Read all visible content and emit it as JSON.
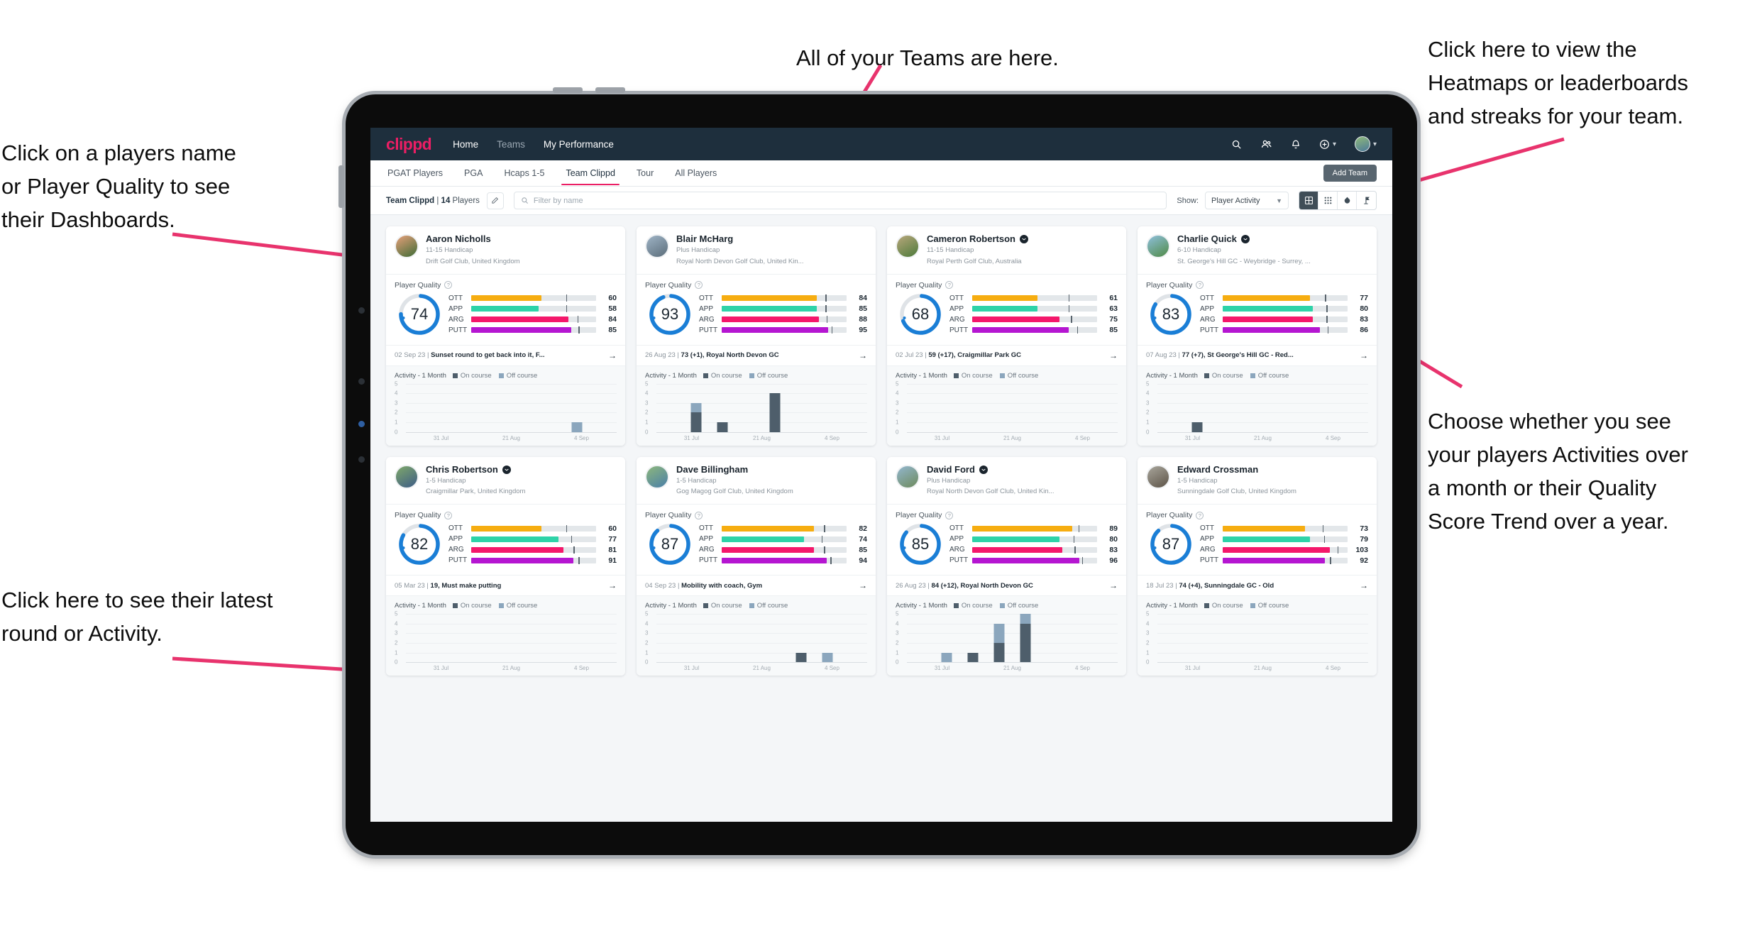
{
  "annotations": [
    {
      "id": "players-name",
      "text": "Click on a players name\nor Player Quality to see\ntheir Dashboards."
    },
    {
      "id": "teams-here",
      "text": "All of your Teams are here."
    },
    {
      "id": "heatmaps",
      "text": "Click here to view the\nHeatmaps or leaderboards\nand streaks for your team."
    },
    {
      "id": "show-toggle",
      "text": "Choose whether you see\nyour players Activities over\na month or their Quality\nScore Trend over a year."
    },
    {
      "id": "latest-round",
      "text": "Click here to see their latest\nround or Activity."
    }
  ],
  "colors": {
    "brand_pink": "#eb1e64",
    "nav_dark": "#1e2f3d",
    "ott": "#f6ad11",
    "app": "#2ed3a8",
    "arg": "#f4186b",
    "putt": "#b516d1",
    "ring_blue": "#1a7ed6",
    "on_course": "#4e5e6b",
    "off_course": "#8ba6bd"
  },
  "topnav": {
    "logo": "clippd",
    "links": [
      {
        "label": "Home",
        "active": true
      },
      {
        "label": "Teams",
        "active": false
      },
      {
        "label": "My Performance",
        "active": true
      }
    ],
    "icons": [
      "search-icon",
      "people-icon",
      "bell-icon",
      "plus-circle-icon",
      "avatar"
    ]
  },
  "tabs": {
    "items": [
      {
        "label": "PGAT Players",
        "active": false
      },
      {
        "label": "PGA",
        "active": false
      },
      {
        "label": "Hcaps 1-5",
        "active": false
      },
      {
        "label": "Team Clippd",
        "active": true
      },
      {
        "label": "Tour",
        "active": false
      },
      {
        "label": "All Players",
        "active": false
      }
    ],
    "add_team_label": "Add Team"
  },
  "filterbar": {
    "team_name": "Team Clippd",
    "player_count": "14",
    "players_word": "Players",
    "separator": " | ",
    "edit_icon": "pencil-icon",
    "search_placeholder": "Filter by name",
    "search_value": "",
    "show_label": "Show:",
    "show_value": "Player Activity",
    "show_options": [
      "Player Activity",
      "Quality Score Trend"
    ],
    "views": [
      {
        "name": "grid-view",
        "active": true
      },
      {
        "name": "dots-grid-view",
        "active": false
      },
      {
        "name": "heatmap-view",
        "active": false
      },
      {
        "name": "leaderboard-view",
        "active": false
      }
    ]
  },
  "card_labels": {
    "player_quality": "Player Quality",
    "activity": "Activity - 1 Month",
    "on_course": "On course",
    "off_course": "Off course",
    "metric_names": [
      "OTT",
      "APP",
      "ARG",
      "PUTT"
    ],
    "x_ticks": [
      "31 Jul",
      "21 Aug",
      "4 Sep"
    ],
    "y_ticks": [
      "5",
      "4",
      "3",
      "2",
      "1",
      "0"
    ]
  },
  "players": [
    {
      "name": "Aaron Nicholls",
      "verified": false,
      "handicap": "11-15 Handicap",
      "club": "Drift Golf Club, United Kingdom",
      "avatar_colors": [
        "#e7a07a",
        "#3e6b35"
      ],
      "quality": 74,
      "metrics": [
        {
          "label": "OTT",
          "value": 60,
          "fill": 56,
          "tick": 76
        },
        {
          "label": "APP",
          "value": 58,
          "fill": 54,
          "tick": 76
        },
        {
          "label": "ARG",
          "value": 84,
          "fill": 78,
          "tick": 85
        },
        {
          "label": "PUTT",
          "value": 85,
          "fill": 80,
          "tick": 86
        }
      ],
      "round_date": "02 Sep 23",
      "round_text": "Sunset round to get back into it, F...",
      "activity": [
        {
          "on": 0,
          "off": 0
        },
        {
          "on": 0,
          "off": 0
        },
        {
          "on": 0,
          "off": 0
        },
        {
          "on": 0,
          "off": 0
        },
        {
          "on": 0,
          "off": 0
        },
        {
          "on": 0,
          "off": 0
        },
        {
          "on": 0,
          "off": 1
        },
        {
          "on": 0,
          "off": 0
        }
      ]
    },
    {
      "name": "Blair McHarg",
      "verified": false,
      "handicap": "Plus Handicap",
      "club": "Royal North Devon Golf Club, United Kin...",
      "avatar_colors": [
        "#9fb4c6",
        "#5b6d7a"
      ],
      "quality": 93,
      "metrics": [
        {
          "label": "OTT",
          "value": 84,
          "fill": 76,
          "tick": 83
        },
        {
          "label": "APP",
          "value": 85,
          "fill": 76,
          "tick": 83
        },
        {
          "label": "ARG",
          "value": 88,
          "fill": 78,
          "tick": 84
        },
        {
          "label": "PUTT",
          "value": 95,
          "fill": 85,
          "tick": 88
        }
      ],
      "round_date": "26 Aug 23",
      "round_text": "73 (+1), Royal North Devon GC",
      "activity": [
        {
          "on": 0,
          "off": 0
        },
        {
          "on": 2,
          "off": 1
        },
        {
          "on": 1,
          "off": 0
        },
        {
          "on": 0,
          "off": 0
        },
        {
          "on": 4,
          "off": 0
        },
        {
          "on": 0,
          "off": 0
        },
        {
          "on": 0,
          "off": 0
        },
        {
          "on": 0,
          "off": 0
        }
      ]
    },
    {
      "name": "Cameron Robertson",
      "verified": true,
      "handicap": "11-15 Handicap",
      "club": "Royal Perth Golf Club, Australia",
      "avatar_colors": [
        "#b9a77c",
        "#4c7a3a"
      ],
      "quality": 68,
      "metrics": [
        {
          "label": "OTT",
          "value": 61,
          "fill": 52,
          "tick": 77
        },
        {
          "label": "APP",
          "value": 63,
          "fill": 52,
          "tick": 77
        },
        {
          "label": "ARG",
          "value": 75,
          "fill": 70,
          "tick": 79
        },
        {
          "label": "PUTT",
          "value": 85,
          "fill": 77,
          "tick": 84
        }
      ],
      "round_date": "02 Jul 23",
      "round_text": "59 (+17), Craigmillar Park GC",
      "activity": [
        {
          "on": 0,
          "off": 0
        },
        {
          "on": 0,
          "off": 0
        },
        {
          "on": 0,
          "off": 0
        },
        {
          "on": 0,
          "off": 0
        },
        {
          "on": 0,
          "off": 0
        },
        {
          "on": 0,
          "off": 0
        },
        {
          "on": 0,
          "off": 0
        },
        {
          "on": 0,
          "off": 0
        }
      ]
    },
    {
      "name": "Charlie Quick",
      "verified": true,
      "handicap": "6-10 Handicap",
      "club": "St. George's Hill GC - Weybridge - Surrey, ...",
      "avatar_colors": [
        "#8fc0dd",
        "#4f8a46"
      ],
      "quality": 83,
      "metrics": [
        {
          "label": "OTT",
          "value": 77,
          "fill": 70,
          "tick": 82
        },
        {
          "label": "APP",
          "value": 80,
          "fill": 72,
          "tick": 83
        },
        {
          "label": "ARG",
          "value": 83,
          "fill": 72,
          "tick": 83
        },
        {
          "label": "PUTT",
          "value": 86,
          "fill": 78,
          "tick": 84
        }
      ],
      "round_date": "07 Aug 23",
      "round_text": "77 (+7), St George's Hill GC - Red...",
      "activity": [
        {
          "on": 0,
          "off": 0
        },
        {
          "on": 1,
          "off": 0
        },
        {
          "on": 0,
          "off": 0
        },
        {
          "on": 0,
          "off": 0
        },
        {
          "on": 0,
          "off": 0
        },
        {
          "on": 0,
          "off": 0
        },
        {
          "on": 0,
          "off": 0
        },
        {
          "on": 0,
          "off": 0
        }
      ]
    },
    {
      "name": "Chris Robertson",
      "verified": true,
      "handicap": "1-5 Handicap",
      "club": "Craigmillar Park, United Kingdom",
      "avatar_colors": [
        "#7fa86a",
        "#3d5c86"
      ],
      "quality": 82,
      "metrics": [
        {
          "label": "OTT",
          "value": 60,
          "fill": 56,
          "tick": 76
        },
        {
          "label": "APP",
          "value": 77,
          "fill": 70,
          "tick": 80
        },
        {
          "label": "ARG",
          "value": 81,
          "fill": 74,
          "tick": 82
        },
        {
          "label": "PUTT",
          "value": 91,
          "fill": 82,
          "tick": 86
        }
      ],
      "round_date": "05 Mar 23",
      "round_text": "19, Must make putting",
      "activity": [
        {
          "on": 0,
          "off": 0
        },
        {
          "on": 0,
          "off": 0
        },
        {
          "on": 0,
          "off": 0
        },
        {
          "on": 0,
          "off": 0
        },
        {
          "on": 0,
          "off": 0
        },
        {
          "on": 0,
          "off": 0
        },
        {
          "on": 0,
          "off": 0
        },
        {
          "on": 0,
          "off": 0
        }
      ]
    },
    {
      "name": "Dave Billingham",
      "verified": false,
      "handicap": "1-5 Handicap",
      "club": "Gog Magog Golf Club, United Kingdom",
      "avatar_colors": [
        "#8db77c",
        "#4a7fa8"
      ],
      "quality": 87,
      "metrics": [
        {
          "label": "OTT",
          "value": 82,
          "fill": 74,
          "tick": 82
        },
        {
          "label": "APP",
          "value": 74,
          "fill": 66,
          "tick": 80
        },
        {
          "label": "ARG",
          "value": 85,
          "fill": 74,
          "tick": 82
        },
        {
          "label": "PUTT",
          "value": 94,
          "fill": 84,
          "tick": 87
        }
      ],
      "round_date": "04 Sep 23",
      "round_text": "Mobility with coach, Gym",
      "activity": [
        {
          "on": 0,
          "off": 0
        },
        {
          "on": 0,
          "off": 0
        },
        {
          "on": 0,
          "off": 0
        },
        {
          "on": 0,
          "off": 0
        },
        {
          "on": 0,
          "off": 0
        },
        {
          "on": 1,
          "off": 0
        },
        {
          "on": 0,
          "off": 1
        },
        {
          "on": 0,
          "off": 0
        }
      ]
    },
    {
      "name": "David Ford",
      "verified": true,
      "handicap": "Plus Handicap",
      "club": "Royal North Devon Golf Club, United Kin...",
      "avatar_colors": [
        "#93b7cf",
        "#6d8a5c"
      ],
      "quality": 85,
      "metrics": [
        {
          "label": "OTT",
          "value": 89,
          "fill": 80,
          "tick": 85
        },
        {
          "label": "APP",
          "value": 80,
          "fill": 70,
          "tick": 81
        },
        {
          "label": "ARG",
          "value": 83,
          "fill": 72,
          "tick": 82
        },
        {
          "label": "PUTT",
          "value": 96,
          "fill": 86,
          "tick": 88
        }
      ],
      "round_date": "26 Aug 23",
      "round_text": "84 (+12), Royal North Devon GC",
      "activity": [
        {
          "on": 0,
          "off": 0
        },
        {
          "on": 0,
          "off": 1
        },
        {
          "on": 1,
          "off": 0
        },
        {
          "on": 2,
          "off": 2
        },
        {
          "on": 4,
          "off": 1
        },
        {
          "on": 0,
          "off": 0
        },
        {
          "on": 0,
          "off": 0
        },
        {
          "on": 0,
          "off": 0
        }
      ]
    },
    {
      "name": "Edward Crossman",
      "verified": false,
      "handicap": "1-5 Handicap",
      "club": "Sunningdale Golf Club, United Kingdom",
      "avatar_colors": [
        "#a9a69c",
        "#5c5347"
      ],
      "quality": 87,
      "metrics": [
        {
          "label": "OTT",
          "value": 73,
          "fill": 66,
          "tick": 80
        },
        {
          "label": "APP",
          "value": 79,
          "fill": 70,
          "tick": 81
        },
        {
          "label": "ARG",
          "value": 103,
          "fill": 86,
          "tick": 92
        },
        {
          "label": "PUTT",
          "value": 92,
          "fill": 82,
          "tick": 86
        }
      ],
      "round_date": "18 Jul 23",
      "round_text": "74 (+4), Sunningdale GC - Old",
      "activity": [
        {
          "on": 0,
          "off": 0
        },
        {
          "on": 0,
          "off": 0
        },
        {
          "on": 0,
          "off": 0
        },
        {
          "on": 0,
          "off": 0
        },
        {
          "on": 0,
          "off": 0
        },
        {
          "on": 0,
          "off": 0
        },
        {
          "on": 0,
          "off": 0
        },
        {
          "on": 0,
          "off": 0
        }
      ]
    }
  ]
}
